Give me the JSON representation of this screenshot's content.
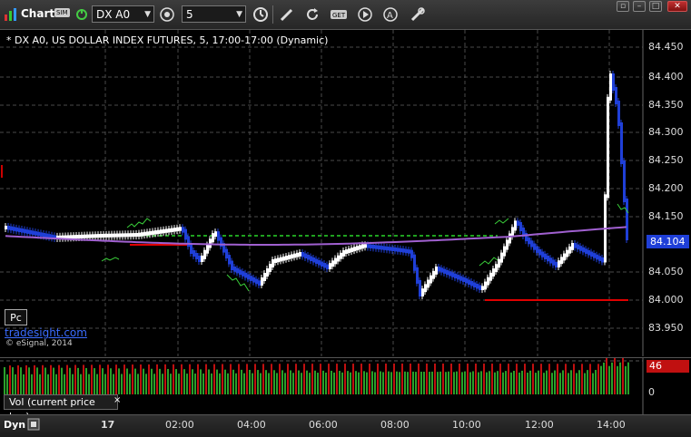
{
  "toolbar": {
    "app_name": "Chart",
    "sim_badge": "SIM",
    "symbol": "DX A0",
    "interval": "5",
    "icons": [
      "chart-logo-icon",
      "sim-badge-icon",
      "link-status-icon",
      "period-settings-icon",
      "clock-icon",
      "draw-pencil-icon",
      "refresh-icon",
      "get-data-icon",
      "play-icon",
      "alert-icon",
      "tools-icon",
      "restore-window-icon",
      "maximize-window-icon",
      "close-window-icon"
    ]
  },
  "chart": {
    "title": "* DX A0, US DOLLAR INDEX FUTURES, 5, 17:00-17:00 (Dynamic)",
    "price_labels": [
      "84.450",
      "84.400",
      "84.350",
      "84.300",
      "84.250",
      "84.200",
      "84.150",
      "84.050",
      "84.000",
      "83.950"
    ],
    "last_price": "84.104",
    "pc_button": "Pc",
    "brand": "tradesight.com",
    "copyright": "© eSignal, 2014",
    "colors": {
      "background": "#000000",
      "up": "#ffffff",
      "down": "#1f3fd8",
      "support": "#e00000",
      "resistance": "#1fa01f",
      "average": "#a060d0",
      "annotation": "#3ad03a"
    }
  },
  "volume": {
    "badge": "46",
    "zero_label": "0",
    "tab_label": "Vol (current price bar)",
    "close_glyph": "×"
  },
  "time_axis": {
    "dyn_label": "Dyn",
    "labels": [
      "17",
      "02:00",
      "04:00",
      "06:00",
      "08:00",
      "10:00",
      "12:00",
      "14:00"
    ]
  }
}
